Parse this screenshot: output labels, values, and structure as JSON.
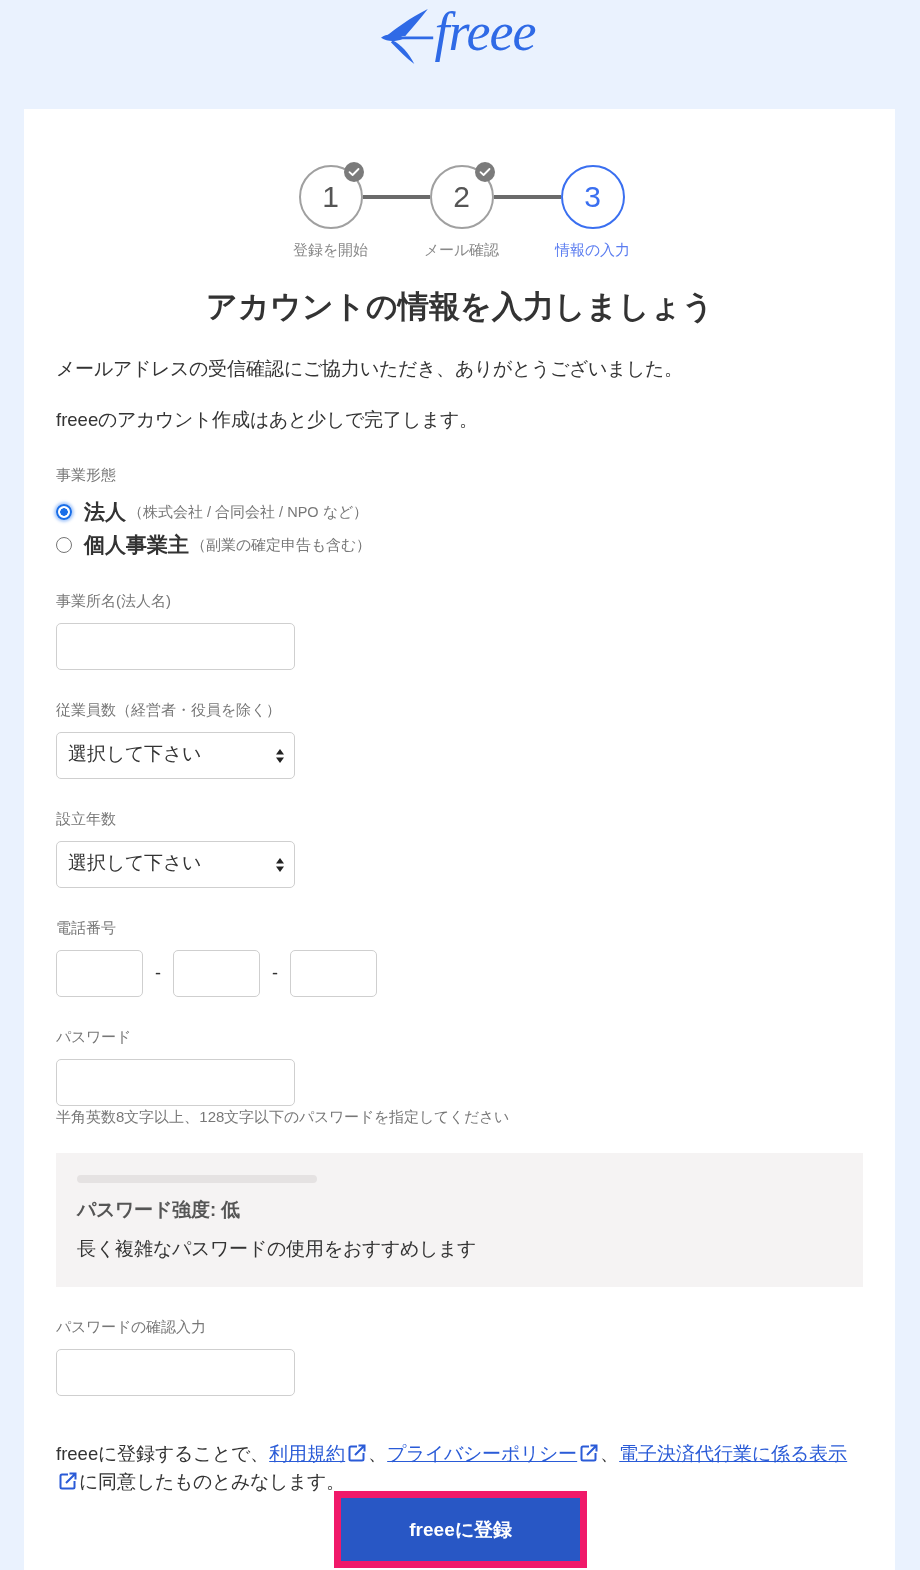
{
  "logo": {
    "text": "freee"
  },
  "steps": [
    {
      "number": "1",
      "label": "登録を開始",
      "completed": true,
      "selected": false
    },
    {
      "number": "2",
      "label": "メール確認",
      "completed": true,
      "selected": false
    },
    {
      "number": "3",
      "label": "情報の入力",
      "completed": false,
      "selected": true
    }
  ],
  "heading": "アカウントの情報を入力しましょう",
  "intro": [
    "メールアドレスの受信確認にご協力いただき、ありがとうございました。",
    "freeeのアカウント作成はあと少しで完了します。"
  ],
  "business_type": {
    "label": "事業形態",
    "options": [
      {
        "label": "法人",
        "note": "（株式会社 / 合同会社 / NPO など）",
        "selected": true
      },
      {
        "label": "個人事業主",
        "note": "（副業の確定申告も含む）",
        "selected": false
      }
    ]
  },
  "fields": [
    {
      "kind": "text",
      "label": "事業所名(法人名)"
    },
    {
      "kind": "select",
      "label": "従業員数（経営者・役員を除く）",
      "value": "選択して下さい"
    },
    {
      "kind": "select",
      "label": "設立年数",
      "value": "選択して下さい"
    },
    {
      "kind": "phone",
      "label": "電話番号",
      "separators": [
        "-",
        "-"
      ]
    },
    {
      "kind": "password",
      "label": "パスワード",
      "hint": "半角英数8文字以上、128文字以下のパスワードを指定してください",
      "strength": {
        "level": 0,
        "title": "パスワード強度: 低",
        "message": "長く複雑なパスワードの使用をおすすめします"
      }
    },
    {
      "kind": "password",
      "label": "パスワードの確認入力"
    }
  ],
  "terms": {
    "parts": [
      {
        "kind": "text",
        "text": "freeeに登録することで、"
      },
      {
        "kind": "link",
        "text": "利用規約"
      },
      {
        "kind": "text",
        "text": "、"
      },
      {
        "kind": "link",
        "text": "プライバシーポリシー"
      },
      {
        "kind": "text",
        "text": "、"
      },
      {
        "kind": "link",
        "text": "電子決済代行業に係る表示"
      },
      {
        "kind": "text",
        "text": "に同意したものとみなします。"
      }
    ]
  },
  "submit": {
    "label": "freeeに登録",
    "highlighted": true
  }
}
